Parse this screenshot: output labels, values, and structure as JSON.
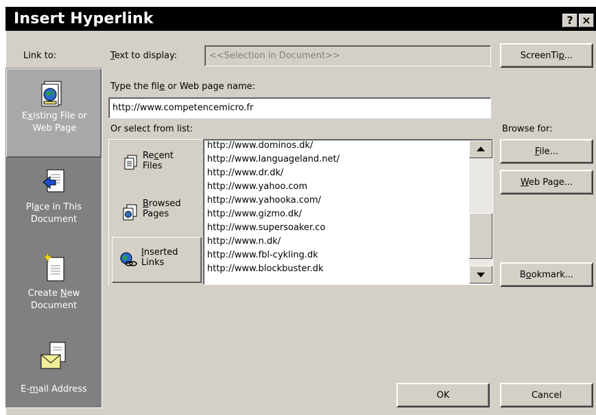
{
  "window": {
    "title": "Insert Hyperlink",
    "help_glyph": "?",
    "close_glyph": "×"
  },
  "link_to": {
    "label": "Link to:",
    "items": [
      {
        "line1": "Existing File or",
        "line2": "Web Page",
        "icon": "web-page-icon",
        "active": true
      },
      {
        "line1": "Place in This",
        "line2": "Document",
        "icon": "document-place-icon",
        "active": false
      },
      {
        "line1": "Create New",
        "line2": "Document",
        "icon": "new-document-icon",
        "active": false
      },
      {
        "line1": "E-mail Address",
        "line2": "",
        "icon": "email-envelope-icon",
        "active": false
      }
    ]
  },
  "text_to_display": {
    "label": "Text to display:",
    "value": "<<Selection in Document>>"
  },
  "screentip_button": "ScreenTip...",
  "filename": {
    "label": "Type the file or Web page name:",
    "value": "http://www.competencemicro.fr"
  },
  "select_list_label": "Or select from list:",
  "browse_for_label": "Browse for:",
  "list_tabs": [
    {
      "line1": "Recent",
      "line2": "Files",
      "icon": "recent-files-icon"
    },
    {
      "line1": "Browsed",
      "line2": "Pages",
      "icon": "browsed-pages-icon"
    },
    {
      "line1": "Inserted",
      "line2": "Links",
      "icon": "inserted-links-icon"
    }
  ],
  "links": [
    "http://www.dominos.dk/",
    "http://www.languageland.net/",
    "http://www.dr.dk/",
    "http://www.yahoo.com",
    "http://www.yahooka.com/",
    "http://www.gizmo.dk/",
    "http://www.supersoaker.co",
    "http://www.n.dk/",
    "http://www.fbl-cykling.dk",
    "http://www.blockbuster.dk"
  ],
  "buttons": {
    "file": "File...",
    "web_page": "Web Page...",
    "bookmark": "Bookmark...",
    "ok": "OK",
    "cancel": "Cancel"
  }
}
